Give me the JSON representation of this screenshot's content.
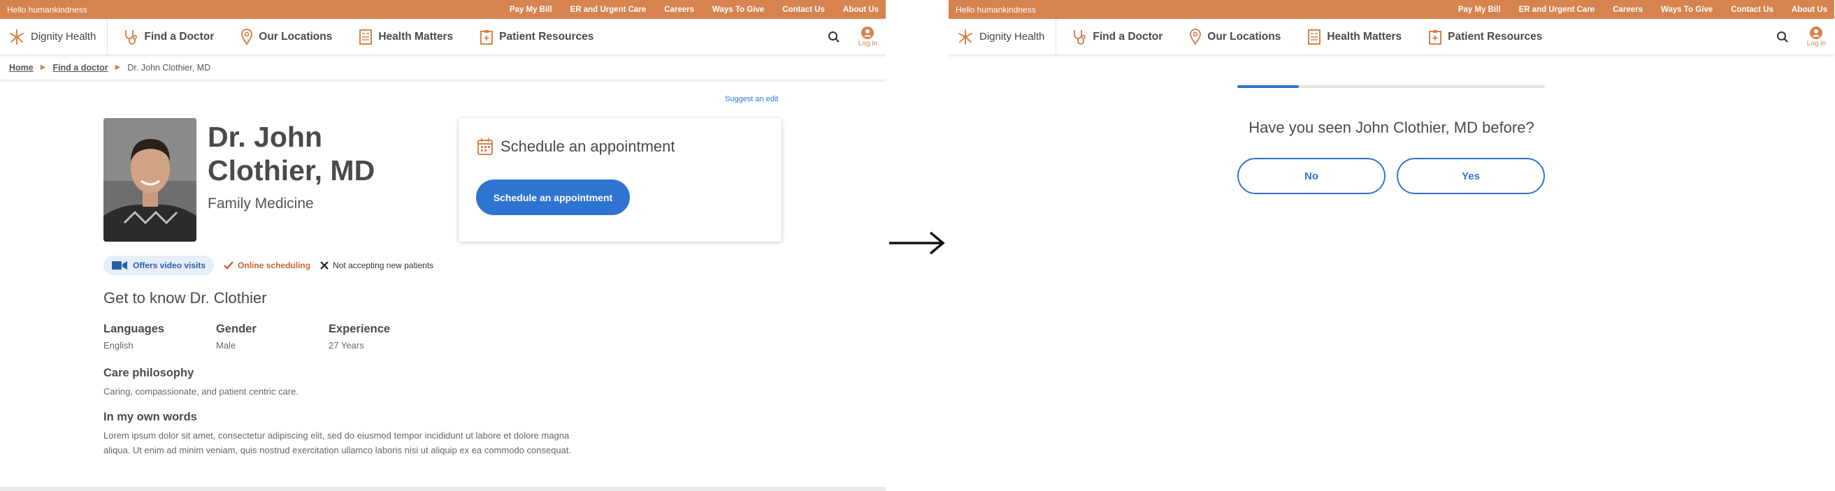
{
  "utility_bar": {
    "greeting": "Hello humankindness",
    "links": [
      "Pay My Bill",
      "ER and Urgent Care",
      "Careers",
      "Ways To Give",
      "Contact Us",
      "About Us"
    ]
  },
  "nav": {
    "brand": "Dignity Health",
    "items": [
      {
        "label": "Find a Doctor",
        "icon": "stethoscope-icon"
      },
      {
        "label": "Our Locations",
        "icon": "location-pin-icon"
      },
      {
        "label": "Health Matters",
        "icon": "article-icon"
      },
      {
        "label": "Patient Resources",
        "icon": "clipboard-icon"
      }
    ],
    "login_label": "Log in"
  },
  "breadcrumb": {
    "home": "Home",
    "find_doctor": "Find a doctor",
    "current": "Dr. John Clothier, MD"
  },
  "profile": {
    "suggest_edit": "Suggest an edit",
    "name": "Dr. John Clothier, MD",
    "specialty": "Family Medicine",
    "tags": {
      "video": "Offers video visits",
      "online": "Online scheduling",
      "not_accepting": "Not accepting new patients"
    },
    "section_title": "Get to know Dr. Clothier",
    "facts": [
      {
        "label": "Languages",
        "value": "English"
      },
      {
        "label": "Gender",
        "value": "Male"
      },
      {
        "label": "Experience",
        "value": "27 Years"
      }
    ],
    "care_philosophy": {
      "label": "Care philosophy",
      "text": "Caring, compassionate, and patient centric care."
    },
    "own_words": {
      "label": "In my own words",
      "text": "Lorem ipsum dolor sit amet, consectetur adipiscing elit, sed do eiusmod tempor incididunt ut labore et dolore magna aliqua. Ut enim ad minim veniam, quis nostrud exercitation ullamco laboris nisi ut aliquip ex ea commodo consequat."
    }
  },
  "schedule": {
    "heading": "Schedule an appointment",
    "button": "Schedule an appointment"
  },
  "question_screen": {
    "progress_fraction": 0.2,
    "question": "Have you seen John Clothier, MD before?",
    "no_label": "No",
    "yes_label": "Yes"
  },
  "colors": {
    "brand_orange": "#d6834f",
    "accent_blue": "#2f74d0"
  }
}
